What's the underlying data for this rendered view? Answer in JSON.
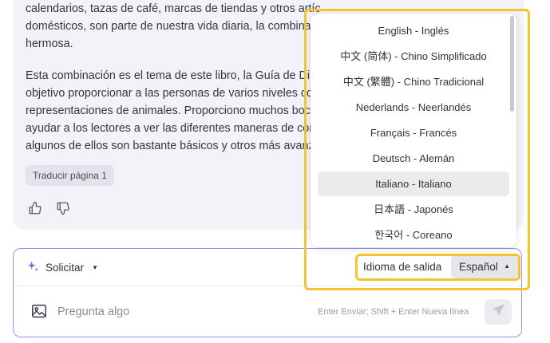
{
  "message": {
    "paragraph1": [
      "calendarios, tazas de café, marcas de tiendas y otros artículos. Ya sea arte o animales",
      "domésticos, son parte de nuestra vida diaria, la combinación de",
      "hermosa."
    ],
    "paragraph2": [
      "Esta combinación es el tema de este libro, la Guía de Dibujo",
      "objetivo proporcionar a las personas de varios niveles con",
      "representaciones de animales. Proporciono muchos bocetos",
      "ayudar a los lectores a ver las diferentes maneras de construir",
      "algunos de ellos son bastante básicos y otros más avanzados"
    ],
    "translate_button": "Traducir página 1"
  },
  "composer": {
    "prompt_mode": "Solicitar",
    "output_language_label": "Idioma de salida",
    "output_language_value": "Español",
    "placeholder": "Pregunta algo",
    "hint": "Enter Enviar; Shift + Enter Nueva línea"
  },
  "language_dropdown": {
    "items": [
      "English - Inglés",
      "中文 (简体) - Chino Simplificado",
      "中文 (繁體) - Chino Tradicional",
      "Nederlands - Neerlandés",
      "Français - Francés",
      "Deutsch - Alemán",
      "Italiano - Italiano",
      "日本語 - Japonés",
      "한국어 - Coreano"
    ],
    "highlighted_item": "Italiano - Italiano"
  },
  "colors": {
    "highlight": "#f4c430",
    "input_border": "#9d8df0",
    "sparkle": "#7b68ee"
  },
  "icons": [
    "thumbs-up-icon",
    "thumbs-down-icon",
    "sparkle-icon",
    "image-icon",
    "send-icon"
  ]
}
